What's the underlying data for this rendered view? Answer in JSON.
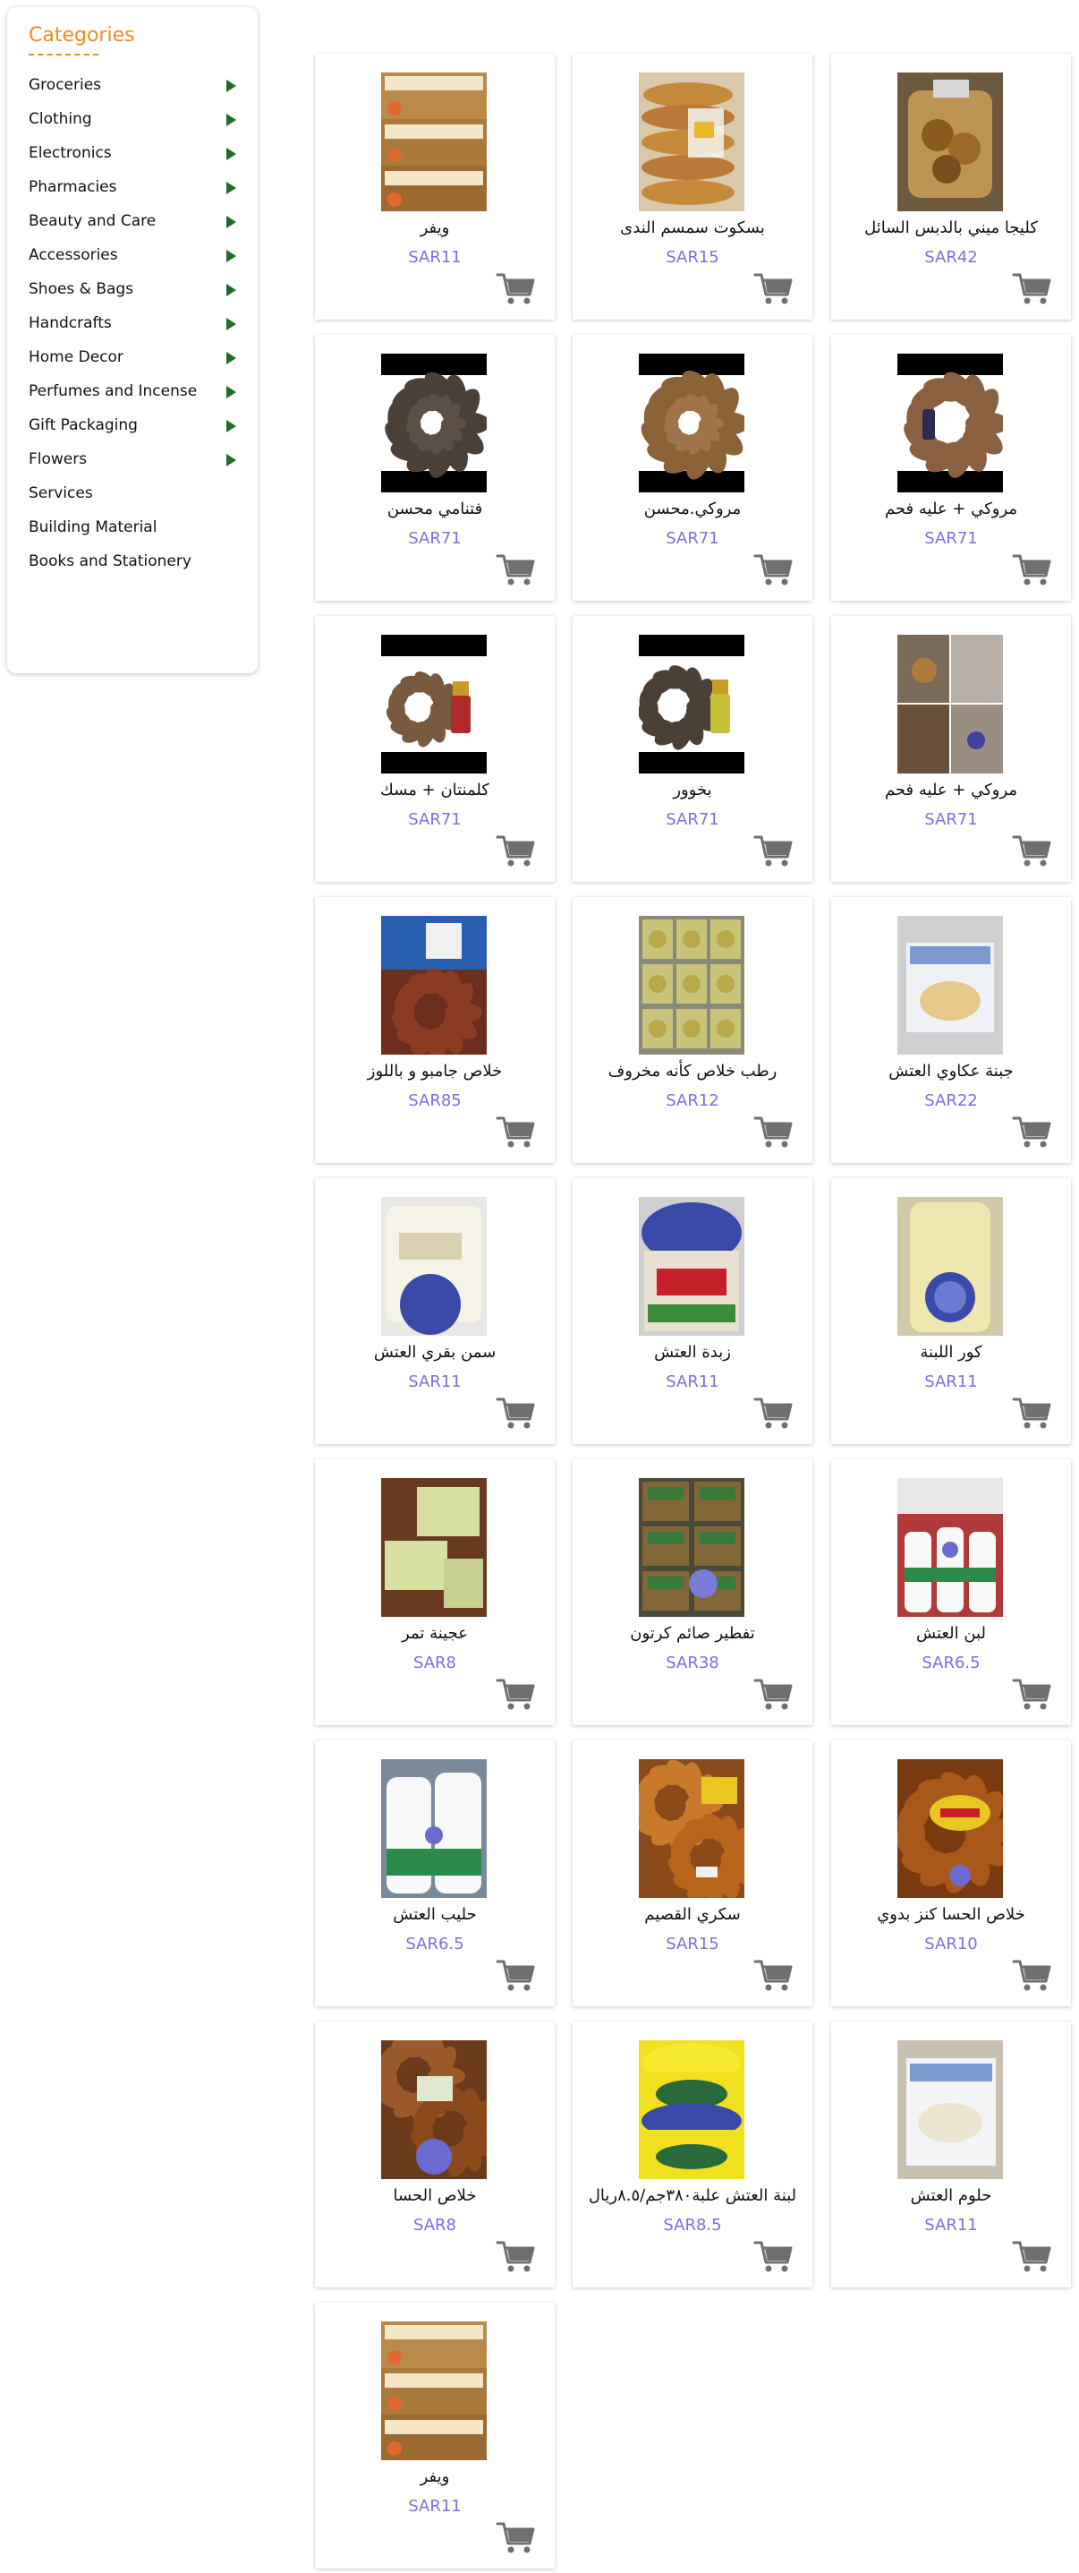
{
  "categories": {
    "title": "Categories",
    "items": [
      {
        "label": "Groceries",
        "has_sub": true
      },
      {
        "label": "Clothing",
        "has_sub": true
      },
      {
        "label": "Electronics",
        "has_sub": true
      },
      {
        "label": "Pharmacies",
        "has_sub": true
      },
      {
        "label": "Beauty and Care",
        "has_sub": true
      },
      {
        "label": "Accessories",
        "has_sub": true
      },
      {
        "label": "Shoes & Bags",
        "has_sub": true
      },
      {
        "label": "Handcrafts",
        "has_sub": true
      },
      {
        "label": "Home Decor",
        "has_sub": true
      },
      {
        "label": "Perfumes and Incense",
        "has_sub": true
      },
      {
        "label": "Gift Packaging",
        "has_sub": true
      },
      {
        "label": "Flowers",
        "has_sub": true
      },
      {
        "label": "Services",
        "has_sub": false
      },
      {
        "label": "Building Material",
        "has_sub": false
      },
      {
        "label": "Books and Stationery",
        "has_sub": false
      }
    ]
  },
  "colors": {
    "accent": "#f08c1e",
    "price": "#7b6fe0",
    "arrow": "#1f6b2e",
    "cart": "#6f6f6f"
  },
  "products": [
    {
      "name": "ويفر",
      "price": "SAR11",
      "image": "wafer-boxes"
    },
    {
      "name": "بسكوت سمسم الندى",
      "price": "SAR15",
      "image": "sesame-biscuits"
    },
    {
      "name": "كليجا ميني بالدبس السائل",
      "price": "SAR42",
      "image": "kleija-jar"
    },
    {
      "name": "فتنامي محسن",
      "price": "SAR71",
      "image": "dark-incense-wood"
    },
    {
      "name": "مروكي.محسن",
      "price": "SAR71",
      "image": "brown-incense-wood"
    },
    {
      "name": "مروكي + عليه فحم",
      "price": "SAR71",
      "image": "incense-with-charcoal"
    },
    {
      "name": "كلمنتان + مسك",
      "price": "SAR71",
      "image": "incense-with-musk"
    },
    {
      "name": "بخوور",
      "price": "SAR71",
      "image": "bukhoor-with-oil"
    },
    {
      "name": "مروكي + عليه فحم",
      "price": "SAR71",
      "image": "incense-collage"
    },
    {
      "name": "خلاص جامبو و باللوز",
      "price": "SAR85",
      "image": "dates-almond-box"
    },
    {
      "name": "رطب خلاص كأنه مخروف",
      "price": "SAR12",
      "image": "fresh-dates-trays"
    },
    {
      "name": "جبنة عكاوي العتش",
      "price": "SAR22",
      "image": "akawi-cheese"
    },
    {
      "name": "سمن بقري العتش",
      "price": "SAR11",
      "image": "ghee-tub"
    },
    {
      "name": "زبدة العتش",
      "price": "SAR11",
      "image": "butter-tub"
    },
    {
      "name": "كور اللبنة",
      "price": "SAR11",
      "image": "labneh-balls-jar"
    },
    {
      "name": "عجينة تمر",
      "price": "SAR8",
      "image": "date-paste"
    },
    {
      "name": "تفطير صائم كرتون",
      "price": "SAR38",
      "image": "iftar-carton"
    },
    {
      "name": "لبن العتش",
      "price": "SAR6.5",
      "image": "laban-bottles"
    },
    {
      "name": "حليب العتش",
      "price": "SAR6.5",
      "image": "milk-bottles"
    },
    {
      "name": "سكري القصيم",
      "price": "SAR15",
      "image": "sukkari-dates"
    },
    {
      "name": "خلاص الحسا كنز بدوي",
      "price": "SAR10",
      "image": "khalas-dates"
    },
    {
      "name": "خلاص الحسا",
      "price": "SAR8",
      "image": "khalas-dates-box"
    },
    {
      "name": "لبنة العتش علبة٣٨٠جم/٨.٥ريال",
      "price": "SAR8.5",
      "image": "labneh-tubs"
    },
    {
      "name": "حلوم العتش",
      "price": "SAR11",
      "image": "halloumi-pack"
    },
    {
      "name": "ويفر",
      "price": "SAR11",
      "image": "wafer-boxes"
    }
  ]
}
